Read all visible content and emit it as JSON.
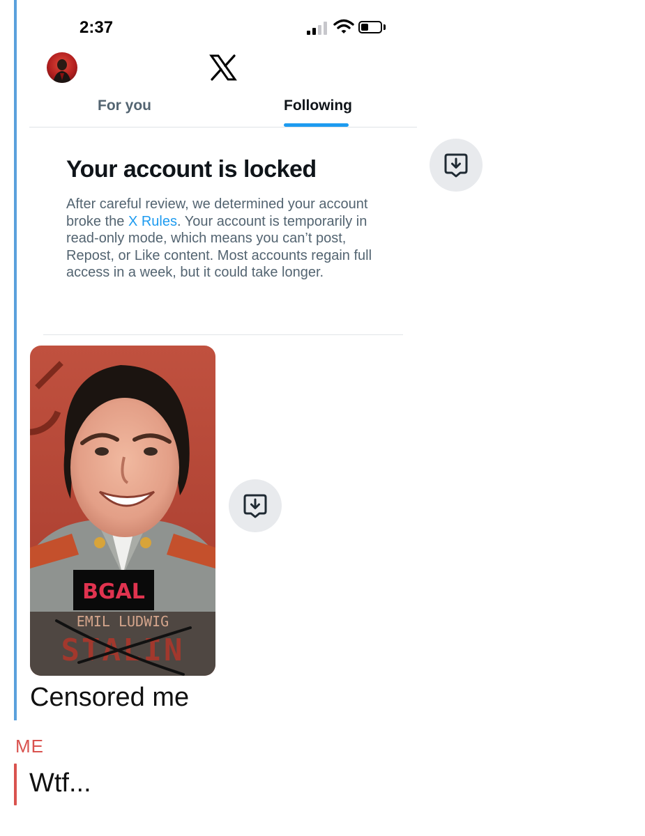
{
  "status_bar": {
    "time": "2:37"
  },
  "tabs": [
    {
      "label": "For you",
      "active": false
    },
    {
      "label": "Following",
      "active": true
    }
  ],
  "lock_notice": {
    "title": "Your account is locked",
    "body_before_link": "After careful review, we determined your account broke the ",
    "link_text": "X Rules",
    "body_after_link": ". Your account is temporarily in read-only mode, which means you can’t post, Repost, or Like content. Most accounts regain full access in a week, but it could take longer."
  },
  "meme": {
    "badge_text": "BGAL",
    "subtitle_text": "EMIL LUDWIG",
    "crossed_text": "STALIN"
  },
  "message": {
    "caption": "Censored me",
    "sender_label": "ME",
    "reply": "Wtf..."
  },
  "icons": {
    "save": "download-box-icon",
    "logo": "x-logo-icon",
    "avatar": "avatar"
  },
  "colors": {
    "accent_blue": "#1d9bf0",
    "quote_bar_blue": "#5aa1dc",
    "me_red": "#d9534f",
    "muted_text": "#536471"
  }
}
